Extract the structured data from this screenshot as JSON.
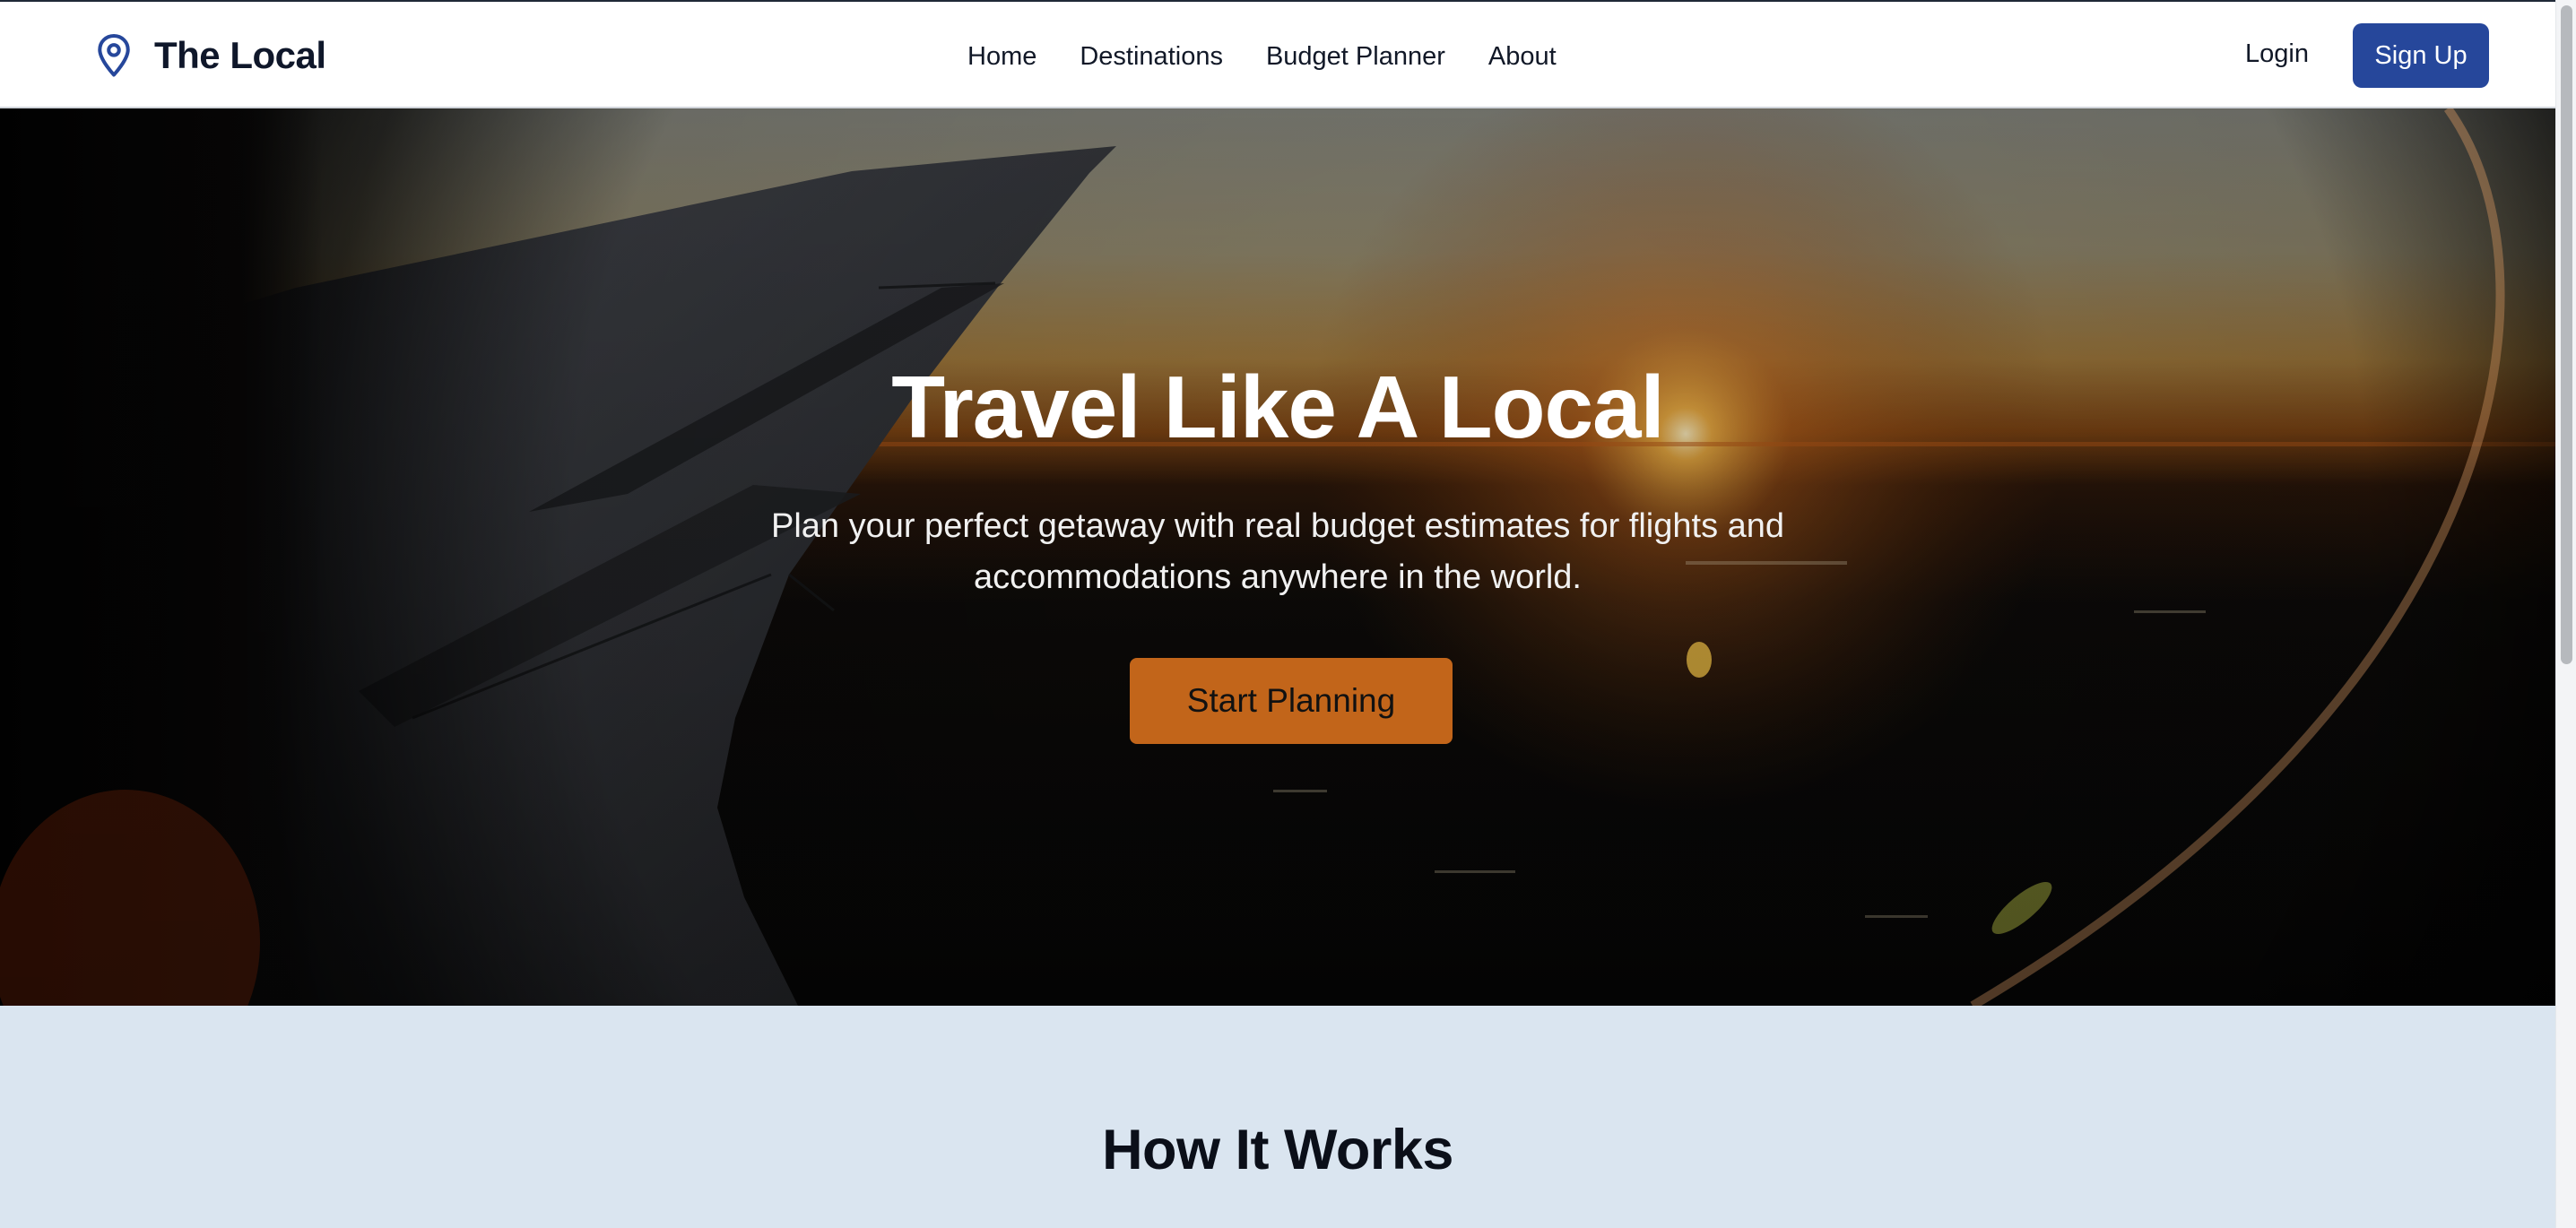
{
  "brand": {
    "name": "The Local",
    "icon": "map-pin-icon",
    "color": "#26479b"
  },
  "nav": {
    "items": [
      {
        "label": "Home"
      },
      {
        "label": "Destinations"
      },
      {
        "label": "Budget Planner"
      },
      {
        "label": "About"
      }
    ]
  },
  "auth": {
    "login_label": "Login",
    "signup_label": "Sign Up"
  },
  "hero": {
    "title": "Travel Like A Local",
    "subtitle": "Plan your perfect getaway with real budget estimates for flights and accommodations anywhere in the world.",
    "cta_label": "Start Planning",
    "background_image": "airplane-wing-sunset-photo"
  },
  "how_it_works": {
    "title": "How It Works"
  },
  "colors": {
    "primary": "#26479b",
    "accent": "#c2651a",
    "section_bg": "#dae5f0"
  }
}
